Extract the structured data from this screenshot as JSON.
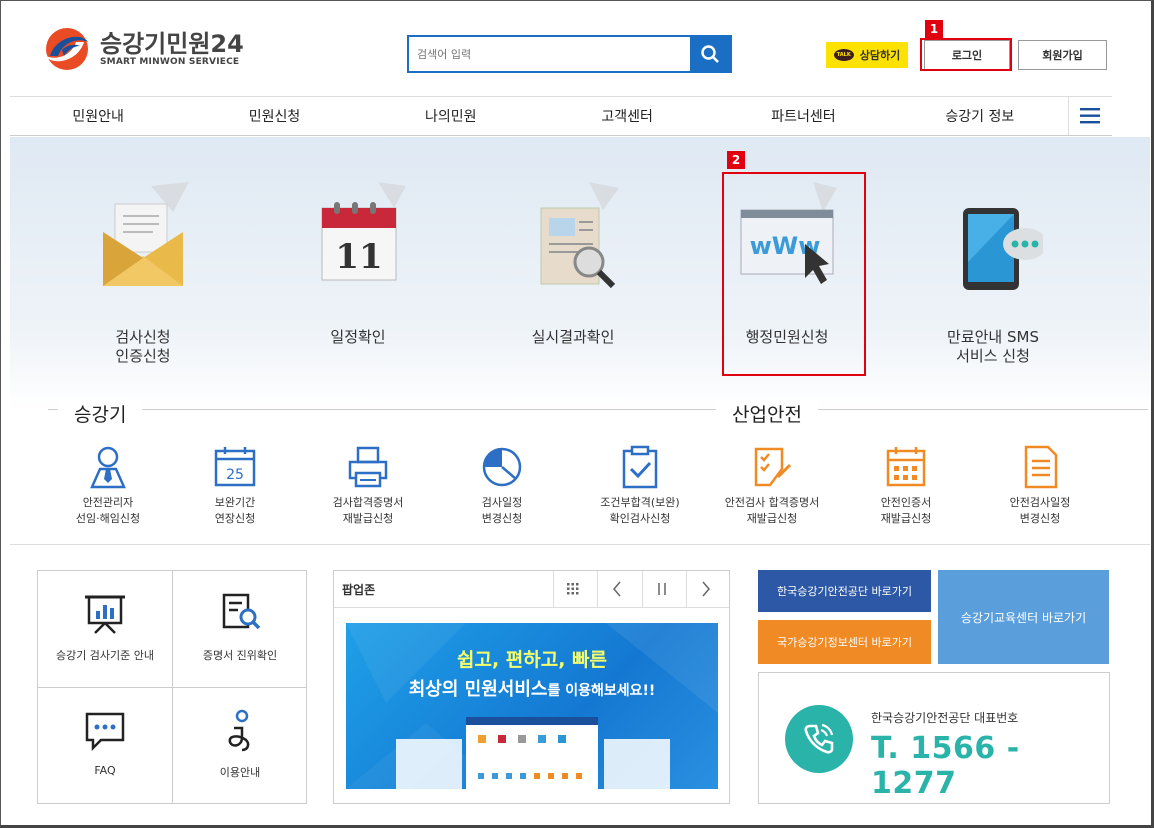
{
  "header": {
    "logo_title": "승강기민원24",
    "logo_sub": "SMART MINWON SERVIECE",
    "search_placeholder": "검색어 입력",
    "talk_label": "상담하기",
    "talk_badge": "TALK",
    "login_label": "로그인",
    "signup_label": "회원가입",
    "badge1": "1",
    "badge2": "2"
  },
  "nav": {
    "items": [
      "민원안내",
      "민원신청",
      "나의민원",
      "고객센터",
      "파트너센터",
      "승강기 정보"
    ]
  },
  "hero": {
    "items": [
      {
        "label": "검사신청\n인증신청"
      },
      {
        "label": "일정확인",
        "icon_text": "11"
      },
      {
        "label": "실시결과확인"
      },
      {
        "label": "행정민원신청",
        "icon_text": "wWw"
      },
      {
        "label": "만료안내 SMS\n서비스 신청"
      }
    ]
  },
  "sections": {
    "left": "승강기",
    "right": "산업안전"
  },
  "small_items": [
    {
      "label": "안전관리자\n선임·해임신청",
      "icon": "person-icon"
    },
    {
      "label": "보완기간\n연장신청",
      "icon": "calendar-icon",
      "icon_text": "25"
    },
    {
      "label": "검사합격증명서\n재발급신청",
      "icon": "printer-icon"
    },
    {
      "label": "검사일정\n변경신청",
      "icon": "pie-chart-icon"
    },
    {
      "label": "조건부합격(보완)\n확인검사신청",
      "icon": "checkbox-clipboard-icon"
    },
    {
      "label": "안전검사 합격증명서\n재발급신청",
      "icon": "check-document-icon"
    },
    {
      "label": "안전인증서\n재발급신청",
      "icon": "calendar-grid-icon"
    },
    {
      "label": "안전검사일정\n변경신청",
      "icon": "document-icon"
    }
  ],
  "quick_grid": [
    {
      "label": "승강기 검사기준 안내",
      "icon": "presentation-chart-icon"
    },
    {
      "label": "증명서 진위확인",
      "icon": "document-search-icon"
    },
    {
      "label": "FAQ",
      "icon": "chat-bubble-icon"
    },
    {
      "label": "이용안내",
      "icon": "info-person-icon"
    }
  ],
  "popup": {
    "title": "팝업존",
    "banner_line1": "쉽고, 편하고, 빠른",
    "banner_line2_a": "최상의 민원서비스",
    "banner_line2_b": "를 이용해보세요!!"
  },
  "links": {
    "kesi": "한국승강기안전공단 바로가기",
    "edu": "승강기교육센터 바로가기",
    "info": "국가승강기정보센터 바로가기"
  },
  "call": {
    "label": "한국승강기안전공단 대표번호",
    "number": "T. 1566 - 1277"
  },
  "colors": {
    "primary": "#1a6fc4",
    "highlight": "#e1000f",
    "talk": "#fde200",
    "teal": "#2ab3a8",
    "link_dark": "#2d58a6",
    "link_light": "#5a9fdc",
    "link_orange": "#f08a24"
  }
}
